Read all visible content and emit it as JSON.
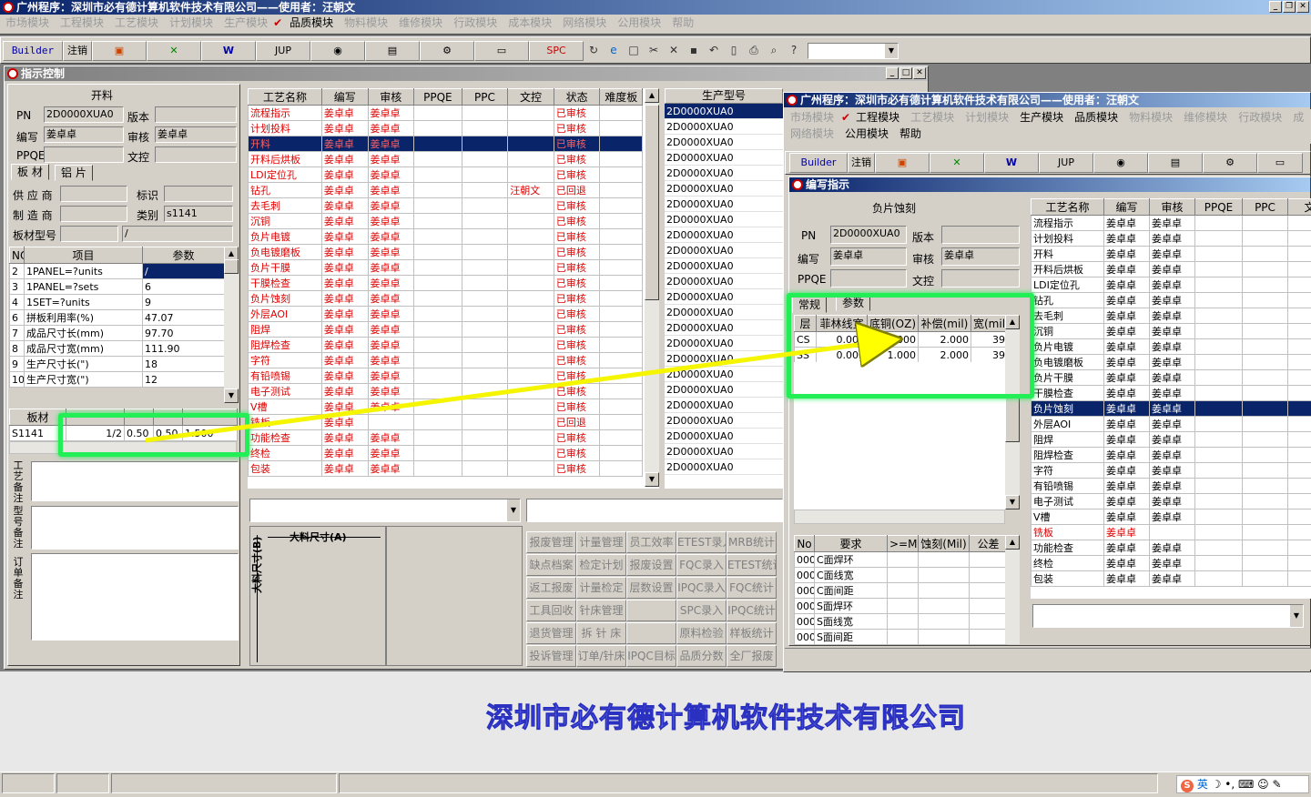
{
  "app": {
    "title": "广州程序：深圳市必有德计算机软件技术有限公司——使用者：汪朝文",
    "menus": [
      "市场模块",
      "工程模块",
      "工艺模块",
      "计划模块",
      "生产模块",
      "品质模块",
      "物料模块",
      "维修模块",
      "行政模块",
      "成本模块",
      "网络模块",
      "公用模块",
      "帮助"
    ],
    "toolbar": {
      "builder": "Builder",
      "logout": "注销",
      "jup": "JUP",
      "spc": "SPC"
    },
    "footer_logo": "深圳市必有德计算机软件技术有限公司"
  },
  "w1": {
    "title": "指示控制",
    "section": "开料",
    "pn_label": "PN",
    "pn": "2D0000XUA0",
    "version_label": "版本",
    "author_label": "编写",
    "author": "姜卓卓",
    "review_label": "审核",
    "review": "姜卓卓",
    "ppqe_label": "PPQE",
    "doc_label": "文控",
    "tabs": [
      "板 材",
      "铝 片"
    ],
    "supplier_label": "供 应 商",
    "mark_label": "标识",
    "maker_label": "制 造 商",
    "class_label": "类别",
    "class": "s1141",
    "model_label": "板材型号",
    "model_val": "/",
    "param_headers": [
      "NO",
      "项目",
      "参数"
    ],
    "params": [
      [
        "2",
        "1PANEL=?units",
        "/"
      ],
      [
        "3",
        "1PANEL=?sets",
        "6"
      ],
      [
        "4",
        "1SET=?units",
        "9"
      ],
      [
        "6",
        "拼板利用率(%)",
        "47.07"
      ],
      [
        "7",
        "成品尺寸长(mm)",
        "97.70"
      ],
      [
        "8",
        "成品尺寸宽(mm)",
        "111.90"
      ],
      [
        "9",
        "生产尺寸长(\")",
        "18"
      ],
      [
        "10",
        "生产尺寸宽(\")",
        "12"
      ]
    ],
    "board_header": "板材",
    "board_row": [
      "S1141",
      "1/2",
      "0.50",
      "0.50",
      "1.500"
    ],
    "notes": [
      "工艺备注",
      "型号备注",
      "订单备注"
    ],
    "proc_headers": [
      "工艺名称",
      "编写",
      "审核",
      "PPQE",
      "PPC",
      "文控",
      "状态",
      "难度板"
    ],
    "processes": [
      [
        "流程指示",
        "姜卓卓",
        "姜卓卓",
        "",
        "",
        "",
        "已审核"
      ],
      [
        "计划投料",
        "姜卓卓",
        "姜卓卓",
        "",
        "",
        "",
        "已审核"
      ],
      [
        "开料",
        "姜卓卓",
        "姜卓卓",
        "",
        "",
        "",
        "已审核"
      ],
      [
        "开料后烘板",
        "姜卓卓",
        "姜卓卓",
        "",
        "",
        "",
        "已审核"
      ],
      [
        "LDI定位孔",
        "姜卓卓",
        "姜卓卓",
        "",
        "",
        "",
        "已审核"
      ],
      [
        "钻孔",
        "姜卓卓",
        "姜卓卓",
        "",
        "",
        "汪朝文",
        "已回退"
      ],
      [
        "去毛刺",
        "姜卓卓",
        "姜卓卓",
        "",
        "",
        "",
        "已审核"
      ],
      [
        "沉铜",
        "姜卓卓",
        "姜卓卓",
        "",
        "",
        "",
        "已审核"
      ],
      [
        "负片电镀",
        "姜卓卓",
        "姜卓卓",
        "",
        "",
        "",
        "已审核"
      ],
      [
        "负电镀磨板",
        "姜卓卓",
        "姜卓卓",
        "",
        "",
        "",
        "已审核"
      ],
      [
        "负片干膜",
        "姜卓卓",
        "姜卓卓",
        "",
        "",
        "",
        "已审核"
      ],
      [
        "干膜检查",
        "姜卓卓",
        "姜卓卓",
        "",
        "",
        "",
        "已审核"
      ],
      [
        "负片蚀刻",
        "姜卓卓",
        "姜卓卓",
        "",
        "",
        "",
        "已审核"
      ],
      [
        "外层AOI",
        "姜卓卓",
        "姜卓卓",
        "",
        "",
        "",
        "已审核"
      ],
      [
        "阻焊",
        "姜卓卓",
        "姜卓卓",
        "",
        "",
        "",
        "已审核"
      ],
      [
        "阻焊检查",
        "姜卓卓",
        "姜卓卓",
        "",
        "",
        "",
        "已审核"
      ],
      [
        "字符",
        "姜卓卓",
        "姜卓卓",
        "",
        "",
        "",
        "已审核"
      ],
      [
        "有铅喷锡",
        "姜卓卓",
        "姜卓卓",
        "",
        "",
        "",
        "已审核"
      ],
      [
        "电子测试",
        "姜卓卓",
        "姜卓卓",
        "",
        "",
        "",
        "已审核"
      ],
      [
        "V槽",
        "姜卓卓",
        "姜卓卓",
        "",
        "",
        "",
        "已审核"
      ],
      [
        "铣板",
        "姜卓卓",
        "",
        "",
        "",
        "",
        "已回退"
      ],
      [
        "功能检查",
        "姜卓卓",
        "姜卓卓",
        "",
        "",
        "",
        "已审核"
      ],
      [
        "终检",
        "姜卓卓",
        "姜卓卓",
        "",
        "",
        "",
        "已审核"
      ],
      [
        "包装",
        "姜卓卓",
        "姜卓卓",
        "",
        "",
        "",
        "已审核"
      ]
    ],
    "model_header": "生产型号",
    "model_code": "2D0000XUA0",
    "size_a": "大料尺寸(A)",
    "size_b": "大料尺寸(B)",
    "buttons": [
      [
        "报废管理",
        "计量管理",
        "员工效率",
        "ETEST录入",
        "MRB统计"
      ],
      [
        "缺点档案",
        "检定计划",
        "报废设置",
        "FQC录入",
        "ETEST统计"
      ],
      [
        "返工报废",
        "计量检定",
        "层数设置",
        "IPQC录入",
        "FQC统计"
      ],
      [
        "工具回收",
        "针床管理",
        "",
        "SPC录入",
        "IPQC统计"
      ],
      [
        "退货管理",
        "拆 针 床",
        "",
        "原料检验",
        "样板统计"
      ],
      [
        "投诉管理",
        "订单/针床",
        "IPQC目标",
        "品质分数",
        "全厂报废"
      ]
    ]
  },
  "w2": {
    "title": "广州程序：深圳市必有德计算机软件技术有限公司——使用者：汪朝文",
    "menus1": [
      "市场模块",
      "工程模块",
      "工艺模块",
      "计划模块",
      "生产模块",
      "品质模块",
      "物料模块",
      "维修模块",
      "行政模块",
      "成"
    ],
    "menus2": [
      "网络模块",
      "公用模块",
      "帮助"
    ],
    "sub_title": "编写指示",
    "section": "负片蚀刻",
    "pn": "2D0000XUA0",
    "author": "姜卓卓",
    "review": "姜卓卓",
    "tabs": [
      "常规",
      "参数"
    ],
    "layer_headers": [
      "层",
      "菲林线宽",
      "底铜(OZ)",
      "补偿(mil)",
      "宽(mil)"
    ],
    "layers": [
      [
        "CS",
        "0.000",
        "1.000",
        "2.000",
        "39"
      ],
      [
        "SS",
        "0.000",
        "1.000",
        "2.000",
        "39"
      ]
    ],
    "req_headers": [
      "No",
      "要求",
      ">=Mil",
      "蚀刻(Mil)",
      "公差"
    ],
    "reqs": [
      [
        "000",
        "C面焊环"
      ],
      [
        "000",
        "C面线宽"
      ],
      [
        "000",
        "C面间距"
      ],
      [
        "000",
        "S面焊环"
      ],
      [
        "000",
        "S面线宽"
      ],
      [
        "000",
        "S面间距"
      ]
    ],
    "proc_headers": [
      "工艺名称",
      "编写",
      "审核",
      "PPQE",
      "PPC",
      "文"
    ],
    "ime": "英"
  }
}
